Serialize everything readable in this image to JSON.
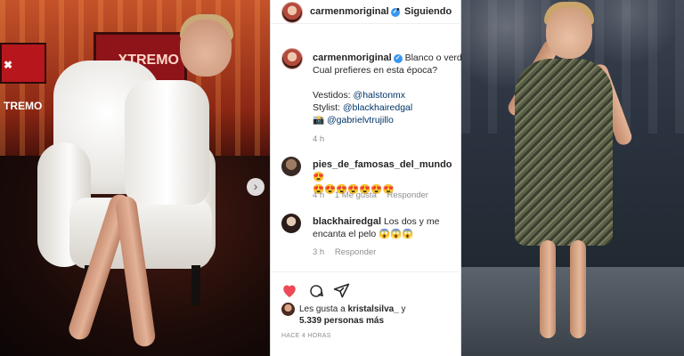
{
  "left_photo": {
    "sign_text": "✖ TREMO",
    "sign2_text": "XTREMO",
    "next_arrow": "›"
  },
  "post": {
    "header": {
      "username": "carmenmoriginal",
      "verified_mark": "✓",
      "separator": "•",
      "follow_label": "Siguiendo"
    },
    "caption": {
      "username": "carmenmoriginal",
      "verified_mark": "✓",
      "line1": "Blanco o verde...",
      "line2": "Cual prefieres en esta época?",
      "dresses_label": "Vestidos: ",
      "dresses_link": "@halstonmx",
      "stylist_label": "Stylist: ",
      "stylist_link": "@blackhairedgal",
      "camera_emoji": "📸",
      "photo_link": "@gabrielvtrujillo",
      "time": "4 h"
    },
    "comments": [
      {
        "username": "pies_de_famosas_del_mundo",
        "text_line1": "😍",
        "text_line2": "😍😍😍😍😍😍😍",
        "time": "4 h",
        "likes": "1 Me gusta",
        "reply": "Responder"
      },
      {
        "username": "blackhairedgal",
        "text": "Los dos y me encanta el pelo 😱😱😱",
        "time": "3 h",
        "reply": "Responder"
      }
    ],
    "actions": {
      "like_icon": "heart-icon",
      "comment_icon": "comment-icon",
      "share_icon": "share-icon",
      "like_color": "#ed4956"
    },
    "likes": {
      "prefix": "Les gusta a ",
      "user": "kristalsilva_",
      "conj": " y",
      "count": "5.339 personas más"
    },
    "time_ago": "HACE 4 HORAS"
  },
  "colors": {
    "link": "#003569",
    "verified": "#3897f0",
    "muted": "#8e8e8e"
  }
}
